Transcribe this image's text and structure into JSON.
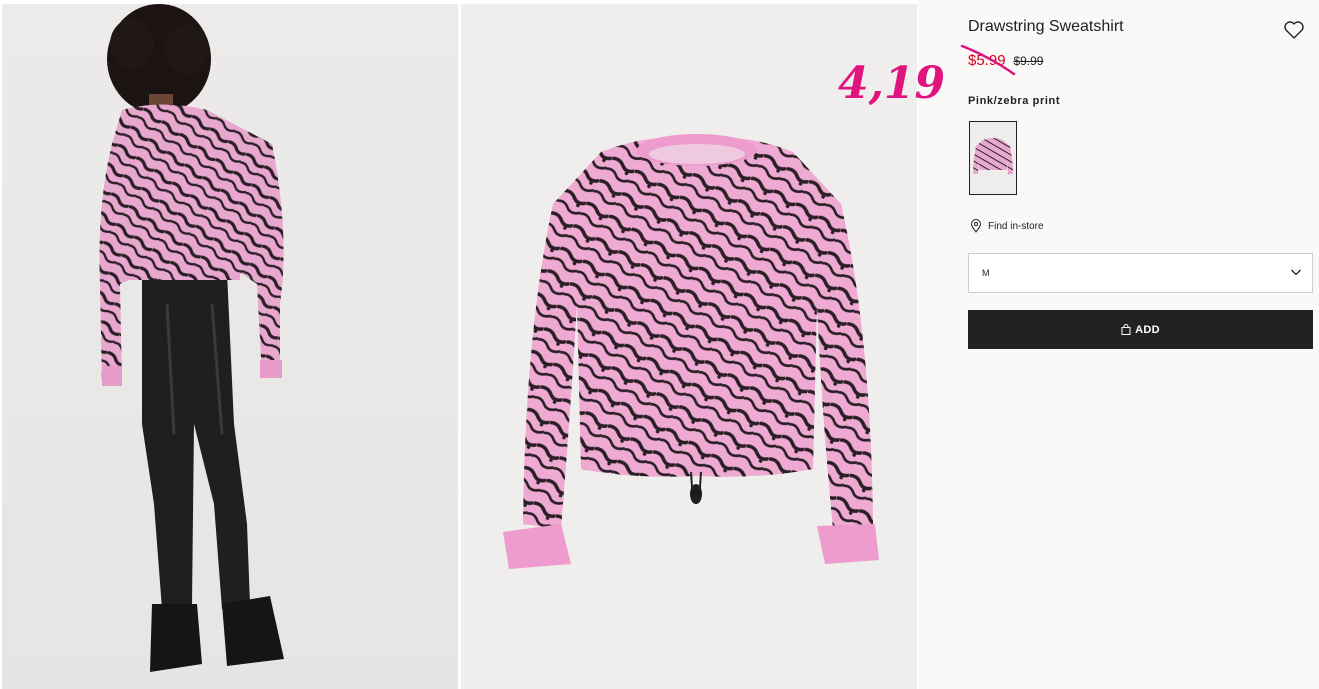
{
  "product": {
    "name": "Drawstring Sweatshirt",
    "sale_price": "$5.99",
    "original_price": "$9.99",
    "annotation_price": "4,19",
    "color_name": "Pink/zebra print",
    "swatch_colors": {
      "pink": "#e8a9cf",
      "dark": "#2a1f24"
    }
  },
  "store": {
    "find_label": "Find in-store"
  },
  "size_select": {
    "selected": "M"
  },
  "actions": {
    "add_label": "ADD"
  },
  "icons": {
    "favorite": "heart-icon",
    "location": "map-pin-icon",
    "dropdown": "chevron-down-icon",
    "bag": "shopping-bag-icon"
  },
  "colors": {
    "sale_red": "#d6001c",
    "annotation_magenta": "#e0137f",
    "button_dark": "#222222"
  }
}
